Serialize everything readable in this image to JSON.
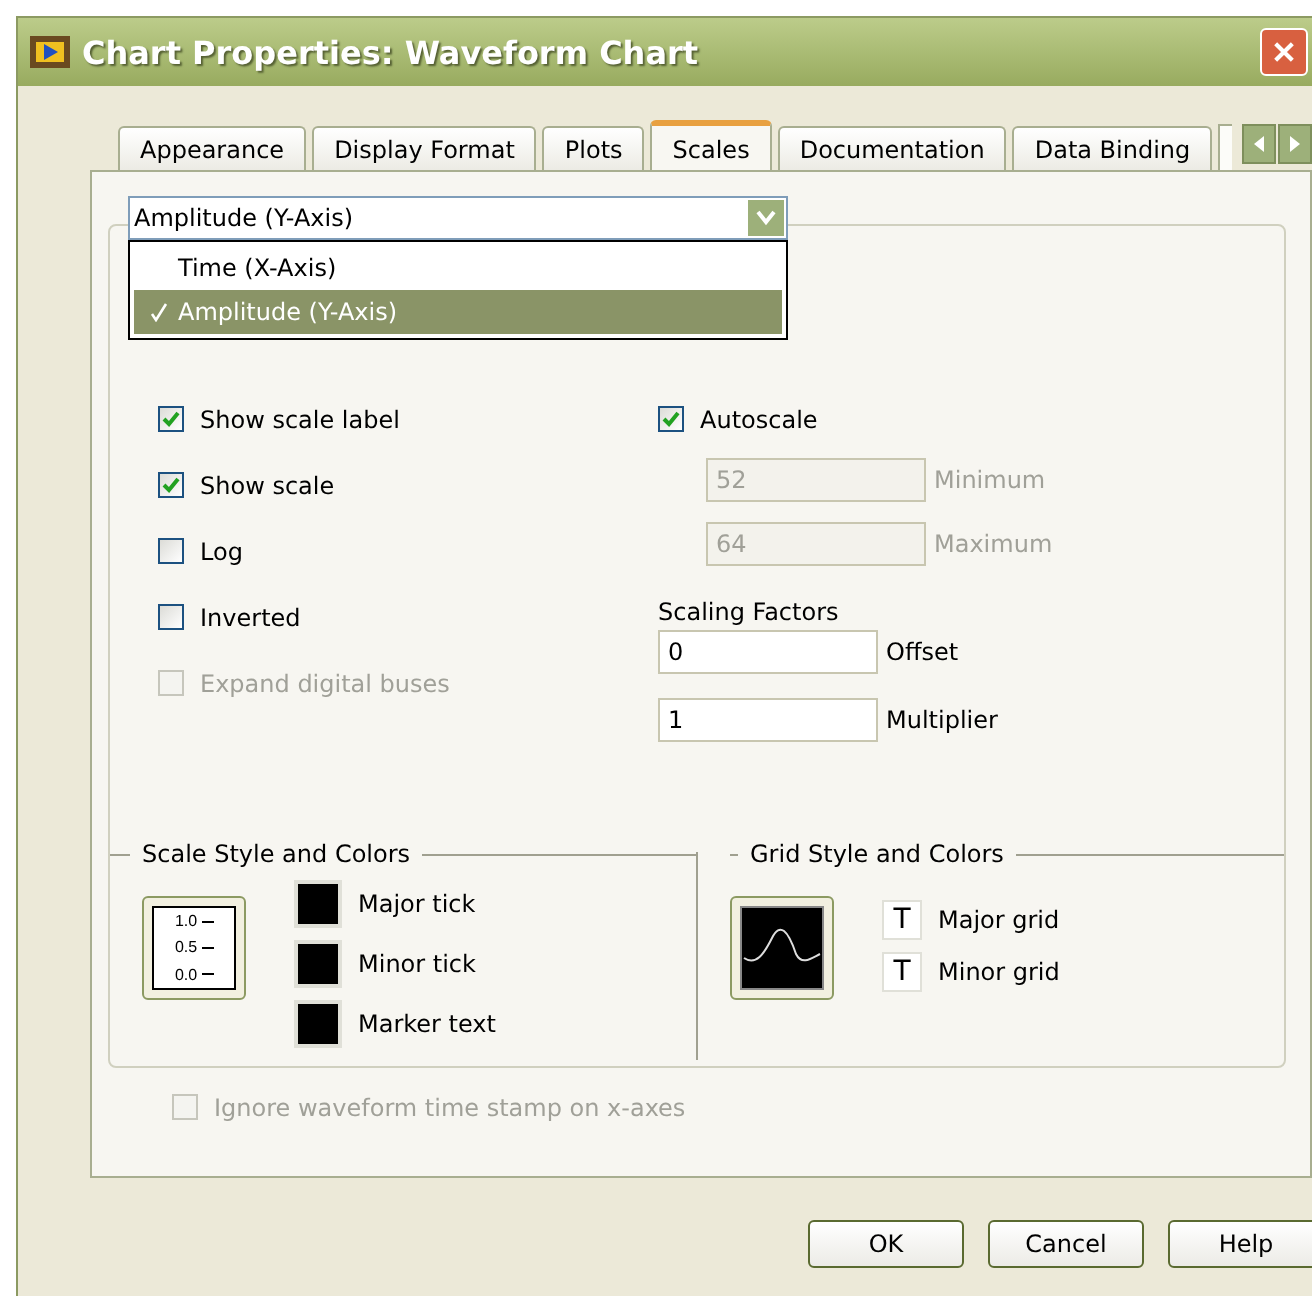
{
  "window": {
    "title": "Chart Properties: Waveform Chart"
  },
  "tabs": [
    {
      "label": "Appearance",
      "selected": false
    },
    {
      "label": "Display Format",
      "selected": false
    },
    {
      "label": "Plots",
      "selected": false
    },
    {
      "label": "Scales",
      "selected": true
    },
    {
      "label": "Documentation",
      "selected": false
    },
    {
      "label": "Data Binding",
      "selected": false
    }
  ],
  "axis_dropdown": {
    "value": "Amplitude (Y-Axis)",
    "expanded": true,
    "options": [
      {
        "label": "Time (X-Axis)",
        "selected": false
      },
      {
        "label": "Amplitude (Y-Axis)",
        "selected": true
      }
    ]
  },
  "left_options": [
    {
      "label": "Show scale label",
      "checked": true,
      "disabled": false
    },
    {
      "label": "Show scale",
      "checked": true,
      "disabled": false
    },
    {
      "label": "Log",
      "checked": false,
      "disabled": false
    },
    {
      "label": "Inverted",
      "checked": false,
      "disabled": false
    },
    {
      "label": "Expand digital buses",
      "checked": false,
      "disabled": true
    }
  ],
  "autoscale": {
    "label": "Autoscale",
    "checked": true
  },
  "range_fields": [
    {
      "value": "52",
      "label": "Minimum",
      "disabled": true
    },
    {
      "value": "64",
      "label": "Maximum",
      "disabled": true
    }
  ],
  "scaling_factors": {
    "title": "Scaling Factors",
    "fields": [
      {
        "value": "0",
        "label": "Offset"
      },
      {
        "value": "1",
        "label": "Multiplier"
      }
    ]
  },
  "scale_style": {
    "title": "Scale Style and Colors",
    "sample_ticks": [
      "1.0",
      "0.5",
      "0.0"
    ],
    "swatches": [
      {
        "label": "Major tick",
        "color": "#000000"
      },
      {
        "label": "Minor tick",
        "color": "#000000"
      },
      {
        "label": "Marker text",
        "color": "#000000"
      }
    ]
  },
  "grid_style": {
    "title": "Grid Style and Colors",
    "items": [
      {
        "symbol": "T",
        "label": "Major grid"
      },
      {
        "symbol": "T",
        "label": "Minor grid"
      }
    ]
  },
  "ignore_timestamp": {
    "label": "Ignore waveform time stamp on x-axes",
    "checked": false,
    "disabled": true
  },
  "buttons": [
    "OK",
    "Cancel",
    "Help"
  ]
}
